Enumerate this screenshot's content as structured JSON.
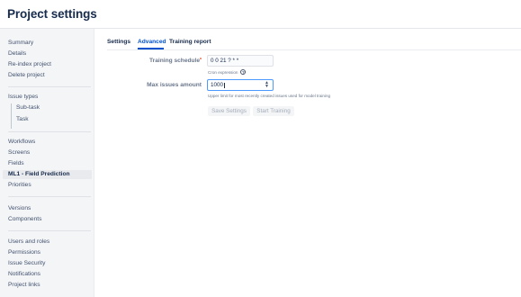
{
  "header": {
    "title": "Project settings"
  },
  "sidebar": {
    "groups": [
      {
        "items": [
          {
            "label": "Summary"
          },
          {
            "label": "Details"
          },
          {
            "label": "Re-index project"
          },
          {
            "label": "Delete project"
          }
        ]
      },
      {
        "items": [
          {
            "label": "Issue types"
          },
          {
            "label": "Sub-task"
          },
          {
            "label": "Task"
          }
        ]
      },
      {
        "items": [
          {
            "label": "Workflows"
          },
          {
            "label": "Screens"
          },
          {
            "label": "Fields"
          },
          {
            "label": "ML1 - Field Prediction",
            "selected": true
          },
          {
            "label": "Priorities"
          }
        ]
      },
      {
        "items": [
          {
            "label": "Versions"
          },
          {
            "label": "Components"
          }
        ]
      },
      {
        "items": [
          {
            "label": "Users and roles"
          },
          {
            "label": "Permissions"
          },
          {
            "label": "Issue Security"
          },
          {
            "label": "Notifications"
          },
          {
            "label": "Project links"
          }
        ]
      }
    ]
  },
  "tabs": [
    {
      "label": "Settings"
    },
    {
      "label": "Advanced",
      "active": true
    },
    {
      "label": "Training report"
    }
  ],
  "form": {
    "schedule": {
      "label": "Training schedule",
      "required_mark": "*",
      "value": "0 0 21 ? * *",
      "helper": "Cron expression",
      "help_icon_glyph": "?"
    },
    "max_issues": {
      "label": "Max issues amount",
      "value": "1000",
      "stepper_up": "▲",
      "stepper_down": "▼",
      "helper": "Upper limit for most recently created issues used for model training"
    },
    "buttons": {
      "save_label": "Save Settings",
      "training_label": "Start Training",
      "enabled": false
    }
  },
  "colors": {
    "accent": "#0052cc",
    "focus_border": "#4c9aff",
    "required": "#de350b",
    "sidebar_bg": "#f4f5f7",
    "disabled_text": "#a5adba"
  }
}
